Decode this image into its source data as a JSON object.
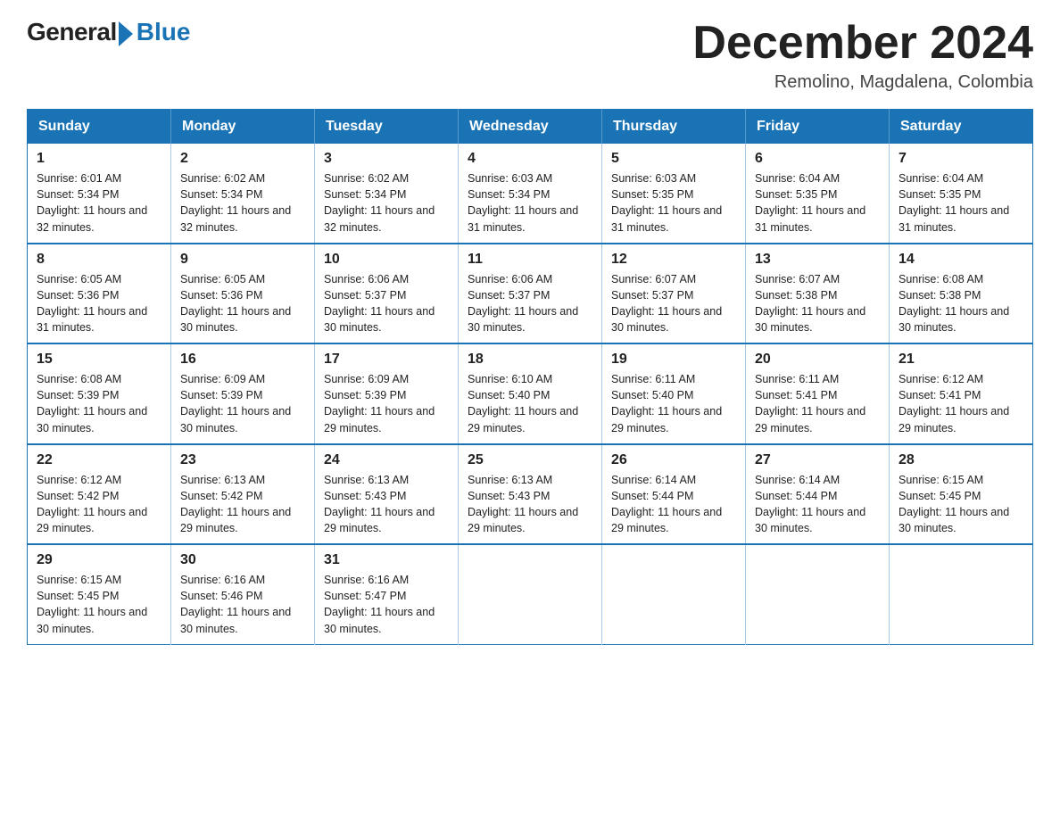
{
  "header": {
    "logo_general": "General",
    "logo_blue": "Blue",
    "month_title": "December 2024",
    "location": "Remolino, Magdalena, Colombia"
  },
  "weekdays": [
    "Sunday",
    "Monday",
    "Tuesday",
    "Wednesday",
    "Thursday",
    "Friday",
    "Saturday"
  ],
  "weeks": [
    [
      {
        "day": "1",
        "sunrise": "6:01 AM",
        "sunset": "5:34 PM",
        "daylight": "11 hours and 32 minutes."
      },
      {
        "day": "2",
        "sunrise": "6:02 AM",
        "sunset": "5:34 PM",
        "daylight": "11 hours and 32 minutes."
      },
      {
        "day": "3",
        "sunrise": "6:02 AM",
        "sunset": "5:34 PM",
        "daylight": "11 hours and 32 minutes."
      },
      {
        "day": "4",
        "sunrise": "6:03 AM",
        "sunset": "5:34 PM",
        "daylight": "11 hours and 31 minutes."
      },
      {
        "day": "5",
        "sunrise": "6:03 AM",
        "sunset": "5:35 PM",
        "daylight": "11 hours and 31 minutes."
      },
      {
        "day": "6",
        "sunrise": "6:04 AM",
        "sunset": "5:35 PM",
        "daylight": "11 hours and 31 minutes."
      },
      {
        "day": "7",
        "sunrise": "6:04 AM",
        "sunset": "5:35 PM",
        "daylight": "11 hours and 31 minutes."
      }
    ],
    [
      {
        "day": "8",
        "sunrise": "6:05 AM",
        "sunset": "5:36 PM",
        "daylight": "11 hours and 31 minutes."
      },
      {
        "day": "9",
        "sunrise": "6:05 AM",
        "sunset": "5:36 PM",
        "daylight": "11 hours and 30 minutes."
      },
      {
        "day": "10",
        "sunrise": "6:06 AM",
        "sunset": "5:37 PM",
        "daylight": "11 hours and 30 minutes."
      },
      {
        "day": "11",
        "sunrise": "6:06 AM",
        "sunset": "5:37 PM",
        "daylight": "11 hours and 30 minutes."
      },
      {
        "day": "12",
        "sunrise": "6:07 AM",
        "sunset": "5:37 PM",
        "daylight": "11 hours and 30 minutes."
      },
      {
        "day": "13",
        "sunrise": "6:07 AM",
        "sunset": "5:38 PM",
        "daylight": "11 hours and 30 minutes."
      },
      {
        "day": "14",
        "sunrise": "6:08 AM",
        "sunset": "5:38 PM",
        "daylight": "11 hours and 30 minutes."
      }
    ],
    [
      {
        "day": "15",
        "sunrise": "6:08 AM",
        "sunset": "5:39 PM",
        "daylight": "11 hours and 30 minutes."
      },
      {
        "day": "16",
        "sunrise": "6:09 AM",
        "sunset": "5:39 PM",
        "daylight": "11 hours and 30 minutes."
      },
      {
        "day": "17",
        "sunrise": "6:09 AM",
        "sunset": "5:39 PM",
        "daylight": "11 hours and 29 minutes."
      },
      {
        "day": "18",
        "sunrise": "6:10 AM",
        "sunset": "5:40 PM",
        "daylight": "11 hours and 29 minutes."
      },
      {
        "day": "19",
        "sunrise": "6:11 AM",
        "sunset": "5:40 PM",
        "daylight": "11 hours and 29 minutes."
      },
      {
        "day": "20",
        "sunrise": "6:11 AM",
        "sunset": "5:41 PM",
        "daylight": "11 hours and 29 minutes."
      },
      {
        "day": "21",
        "sunrise": "6:12 AM",
        "sunset": "5:41 PM",
        "daylight": "11 hours and 29 minutes."
      }
    ],
    [
      {
        "day": "22",
        "sunrise": "6:12 AM",
        "sunset": "5:42 PM",
        "daylight": "11 hours and 29 minutes."
      },
      {
        "day": "23",
        "sunrise": "6:13 AM",
        "sunset": "5:42 PM",
        "daylight": "11 hours and 29 minutes."
      },
      {
        "day": "24",
        "sunrise": "6:13 AM",
        "sunset": "5:43 PM",
        "daylight": "11 hours and 29 minutes."
      },
      {
        "day": "25",
        "sunrise": "6:13 AM",
        "sunset": "5:43 PM",
        "daylight": "11 hours and 29 minutes."
      },
      {
        "day": "26",
        "sunrise": "6:14 AM",
        "sunset": "5:44 PM",
        "daylight": "11 hours and 29 minutes."
      },
      {
        "day": "27",
        "sunrise": "6:14 AM",
        "sunset": "5:44 PM",
        "daylight": "11 hours and 30 minutes."
      },
      {
        "day": "28",
        "sunrise": "6:15 AM",
        "sunset": "5:45 PM",
        "daylight": "11 hours and 30 minutes."
      }
    ],
    [
      {
        "day": "29",
        "sunrise": "6:15 AM",
        "sunset": "5:45 PM",
        "daylight": "11 hours and 30 minutes."
      },
      {
        "day": "30",
        "sunrise": "6:16 AM",
        "sunset": "5:46 PM",
        "daylight": "11 hours and 30 minutes."
      },
      {
        "day": "31",
        "sunrise": "6:16 AM",
        "sunset": "5:47 PM",
        "daylight": "11 hours and 30 minutes."
      },
      null,
      null,
      null,
      null
    ]
  ]
}
